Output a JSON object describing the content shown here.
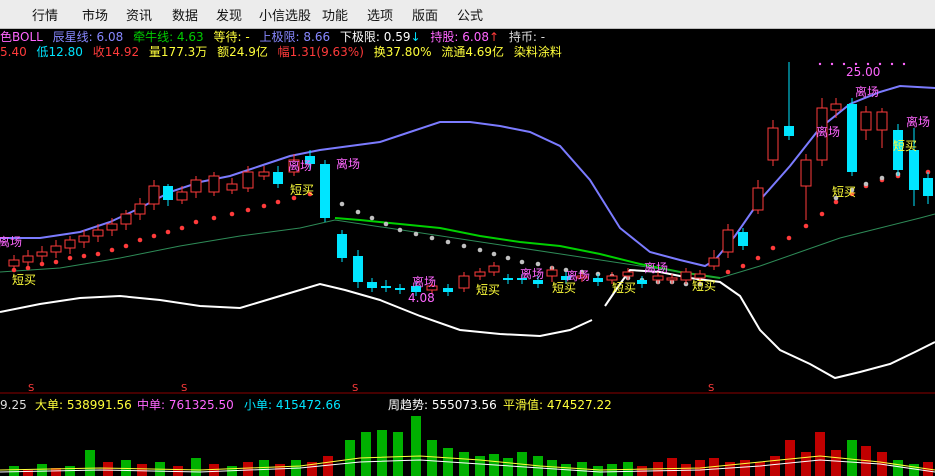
{
  "menu": [
    "行情",
    "市场",
    "资讯",
    "数据",
    "发现",
    "小信选股",
    "功能",
    "选项",
    "版面",
    "公式"
  ],
  "info_row1": {
    "indicator": "色BOLL",
    "chenxing": "辰星线: 6.08",
    "qianniu": "牵牛线: 4.63",
    "dengdai": "等待: -",
    "upper": "上极限: 8.66",
    "lower": "下极限: 0.59",
    "lower_arrow": "↓",
    "chigu": "持股: 6.08",
    "chigu_arrow": "↑",
    "chibi": "持币: -"
  },
  "info_row2": {
    "high": "5.40",
    "low": "低12.80",
    "close": "收14.92",
    "volume": "量177.3万",
    "amount": "额24.9亿",
    "change": "幅1.31(9.63%)",
    "turnover": "换37.80%",
    "float": "流通4.69亿",
    "industry": "染料涂料"
  },
  "labels": {
    "likai": "离场",
    "duanmai": "短买",
    "price_high": "25.00",
    "price_low": "4.08",
    "s_marker": "S"
  },
  "flow_row": {
    "prefix": "9.25",
    "dadan": "大单: 538991.56",
    "zhongdan": "中单: 761325.50",
    "xiaodan": "小单: 415472.66",
    "zhouqushi": "周趋势: 555073.56",
    "pinghua": "平滑值: 474527.22"
  },
  "colors": {
    "up": "#ff3b3b",
    "down": "#00e5ff",
    "upper_band": "#7b7bff",
    "mid_green": "#00d000",
    "white_line": "#ffffff",
    "yellow": "#ffff3b",
    "magenta": "#ff66ff"
  }
}
